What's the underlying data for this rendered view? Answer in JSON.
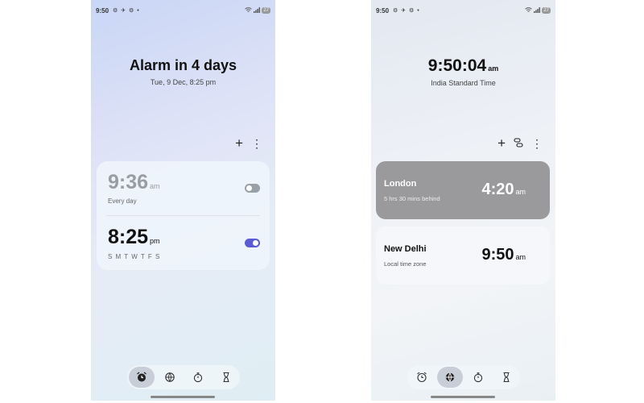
{
  "left": {
    "status": {
      "time": "9:50",
      "icons": "⚙ ✈ ⚙ •",
      "battery": "27"
    },
    "header": {
      "title": "Alarm in 4 days",
      "subtitle": "Tue, 9 Dec, 8:25 pm"
    },
    "toolbar": {
      "add": "+",
      "more": "⋮"
    },
    "alarms": [
      {
        "time": "9:36",
        "ampm": "am",
        "repeat": "Every day",
        "enabled": false
      },
      {
        "time": "8:25",
        "ampm": "pm",
        "days": "S M T W T F S",
        "enabled": true
      }
    ],
    "nav": {
      "active": "alarm",
      "items": [
        "alarm-icon",
        "world-clock-icon",
        "stopwatch-icon",
        "timer-icon"
      ]
    }
  },
  "right": {
    "status": {
      "time": "9:50",
      "icons": "⚙ ✈ ⚙ •",
      "battery": "27"
    },
    "clock": {
      "time": "9:50:04",
      "ampm": "am",
      "zone": "India Standard Time"
    },
    "toolbar": {
      "add": "+",
      "more": "⋮"
    },
    "cities": [
      {
        "name": "London",
        "sub": "5 hrs 30 mins behind",
        "time": "4:20",
        "ampm": "am"
      },
      {
        "name": "New Delhi",
        "sub": "Local time zone",
        "time": "9:50",
        "ampm": "am"
      }
    ],
    "nav": {
      "active": "world-clock",
      "items": [
        "alarm-icon",
        "world-clock-icon",
        "stopwatch-icon",
        "timer-icon"
      ]
    }
  },
  "colors": {
    "toggle_on": "#5b5bd6",
    "toggle_off": "#9aa0a8",
    "london_card": "#9a9a9c"
  }
}
